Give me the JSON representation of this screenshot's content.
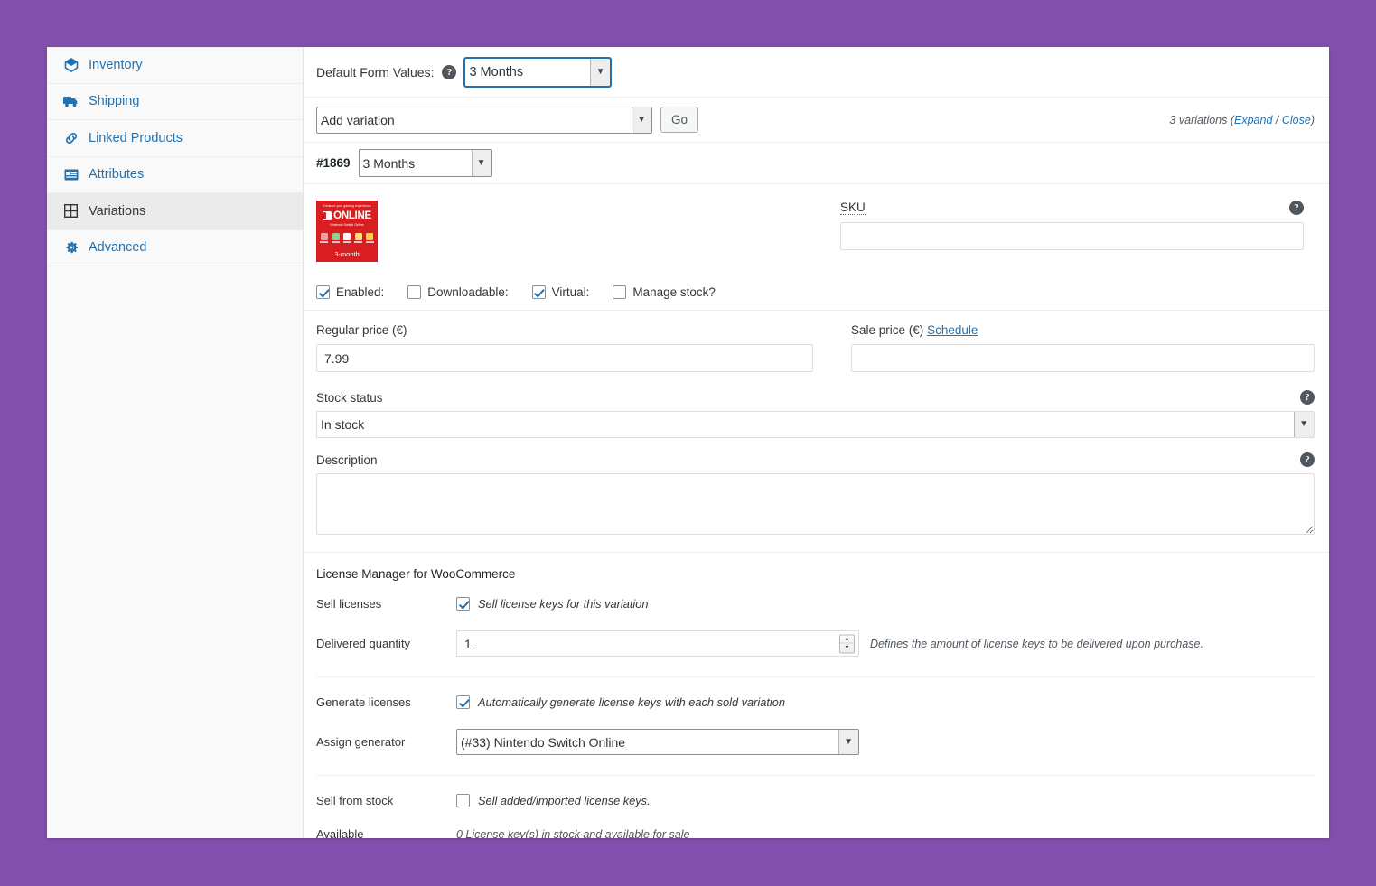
{
  "theme": {
    "background": "#8250ac",
    "panel": "#ffffff",
    "link": "#2271b1",
    "sidebar_bg": "#f9f9f9",
    "thumb_bg": "#d81e20"
  },
  "sidebar": {
    "items": [
      {
        "label": "Inventory",
        "icon": "inventory-icon",
        "active": false
      },
      {
        "label": "Shipping",
        "icon": "truck-icon",
        "active": false
      },
      {
        "label": "Linked Products",
        "icon": "link-icon",
        "active": false
      },
      {
        "label": "Attributes",
        "icon": "attributes-icon",
        "active": false
      },
      {
        "label": "Variations",
        "icon": "grid-icon",
        "active": true
      },
      {
        "label": "Advanced",
        "icon": "gear-icon",
        "active": false
      }
    ]
  },
  "toolbar": {
    "default_form_values_label": "Default Form Values:",
    "default_form_values_help": "?",
    "default_form_value": "3 Months",
    "add_variation_value": "Add variation",
    "go_label": "Go",
    "variation_count_text": "3 variations",
    "expand_label": "Expand",
    "separator": "/",
    "close_label": "Close"
  },
  "variation": {
    "id_label": "#1869",
    "attribute_value": "3 Months",
    "thumbnail": {
      "top_text": "Enhance your gaming experience",
      "brand_text": "ONLINE",
      "sub_text": "Nintendo Switch Online",
      "duration_text": "3-month"
    },
    "sku": {
      "label": "SKU",
      "value": "",
      "help": "?"
    },
    "checkboxes": [
      {
        "label": "Enabled:",
        "checked": true
      },
      {
        "label": "Downloadable:",
        "checked": false
      },
      {
        "label": "Virtual:",
        "checked": true
      },
      {
        "label": "Manage stock?",
        "checked": false
      }
    ],
    "regular_price": {
      "label": "Regular price (€)",
      "value": "7.99"
    },
    "sale_price": {
      "label": "Sale price (€)",
      "schedule_label": "Schedule",
      "value": ""
    },
    "stock_status": {
      "label": "Stock status",
      "value": "In stock",
      "help": "?"
    },
    "description": {
      "label": "Description",
      "value": "",
      "help": "?"
    }
  },
  "license_manager": {
    "title": "License Manager for WooCommerce",
    "sell_licenses": {
      "label": "Sell licenses",
      "checkbox_label": "Sell license keys for this variation",
      "checked": true
    },
    "delivered_quantity": {
      "label": "Delivered quantity",
      "value": "1",
      "note": "Defines the amount of license keys to be delivered upon purchase."
    },
    "generate_licenses": {
      "label": "Generate licenses",
      "checkbox_label": "Automatically generate license keys with each sold variation",
      "checked": true
    },
    "assign_generator": {
      "label": "Assign generator",
      "value": "(#33) Nintendo Switch Online"
    },
    "sell_from_stock": {
      "label": "Sell from stock",
      "checkbox_label": "Sell added/imported license keys.",
      "checked": false
    },
    "available": {
      "label": "Available",
      "text": "0 License key(s) in stock and available for sale"
    }
  }
}
